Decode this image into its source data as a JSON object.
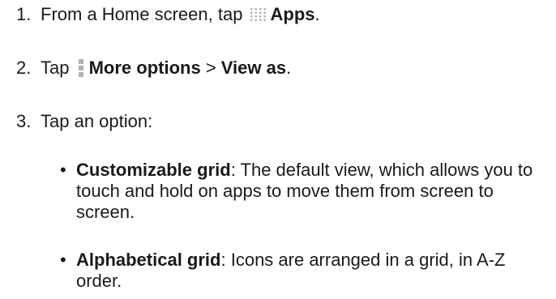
{
  "steps": [
    {
      "number": "1.",
      "pre": "From a Home screen, tap ",
      "icon": "apps-grid-icon",
      "bold": "Apps",
      "post": "."
    },
    {
      "number": "2.",
      "pre": "Tap ",
      "icon": "more-options-icon",
      "bold": "More options",
      "mid": " > ",
      "bold2": "View as",
      "post": "."
    },
    {
      "number": "3.",
      "text": "Tap an option:"
    }
  ],
  "options": [
    {
      "name": "Customizable grid",
      "separator": ":",
      "description": " The default view, which allows you to touch and hold on apps to move them from screen to screen."
    },
    {
      "name": "Alphabetical grid",
      "separator": ":",
      "description": " Icons are arranged in a grid, in A-Z order."
    }
  ],
  "colors": {
    "text": "#1a1a1a",
    "icon": "#b0b0b0"
  }
}
